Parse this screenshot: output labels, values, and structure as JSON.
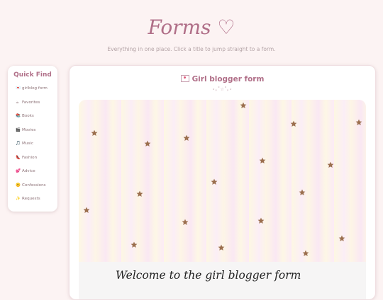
{
  "header": {
    "title": "Forms ♡",
    "subtitle": "Everything in one place. Click a title to jump straight to a form."
  },
  "sidebar": {
    "title": "Quick Find",
    "items": [
      {
        "icon": "💌",
        "label": "girlblog form"
      },
      {
        "icon": "☕",
        "label": "Favorites"
      },
      {
        "icon": "📚",
        "label": "Books"
      },
      {
        "icon": "🎬",
        "label": "Movies"
      },
      {
        "icon": "🎵",
        "label": "Music"
      },
      {
        "icon": "👠",
        "label": "Fashion"
      },
      {
        "icon": "💕",
        "label": "Advice"
      },
      {
        "icon": "🤫",
        "label": "Confessions"
      },
      {
        "icon": "✨",
        "label": "Requests"
      }
    ]
  },
  "form": {
    "title": "Girl blogger form",
    "decoration": "⋆｡˚☆˚｡⋆",
    "welcome_heading": "Welcome to the girl blogger form"
  },
  "colors": {
    "accent": "#b06f88",
    "star": "#9b6f4e",
    "background": "#fcf3f3"
  }
}
